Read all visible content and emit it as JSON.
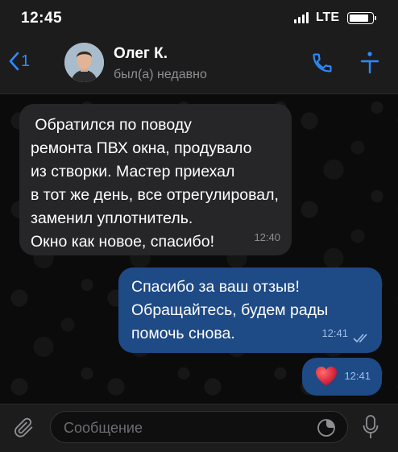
{
  "status_bar": {
    "time": "12:45",
    "network": "LTE",
    "battery_level": 0.85
  },
  "header": {
    "back_count": "1",
    "contact_name": "Олег К.",
    "contact_status": "был(а) недавно"
  },
  "messages": [
    {
      "direction": "incoming",
      "text": " Обратился по поводу\nремонта ПВХ окна, продувало\nиз створки. Мастер приехал\nв тот же день, все отрегулировал,\nзаменил уплотнитель.\nОкно как новое, спасибо!",
      "time": "12:40"
    },
    {
      "direction": "outgoing",
      "text": "Спасибо за ваш отзыв!\nОбращайтесь, будем рады\nпомочь снова.",
      "time": "12:41",
      "status": "read"
    },
    {
      "direction": "outgoing",
      "emoji": "heart",
      "time": "12:41"
    }
  ],
  "composer": {
    "placeholder": "Сообщение"
  },
  "colors": {
    "accent": "#2d8bff",
    "outgoing_bubble": "#1e4a85",
    "incoming_bubble": "#262628"
  }
}
